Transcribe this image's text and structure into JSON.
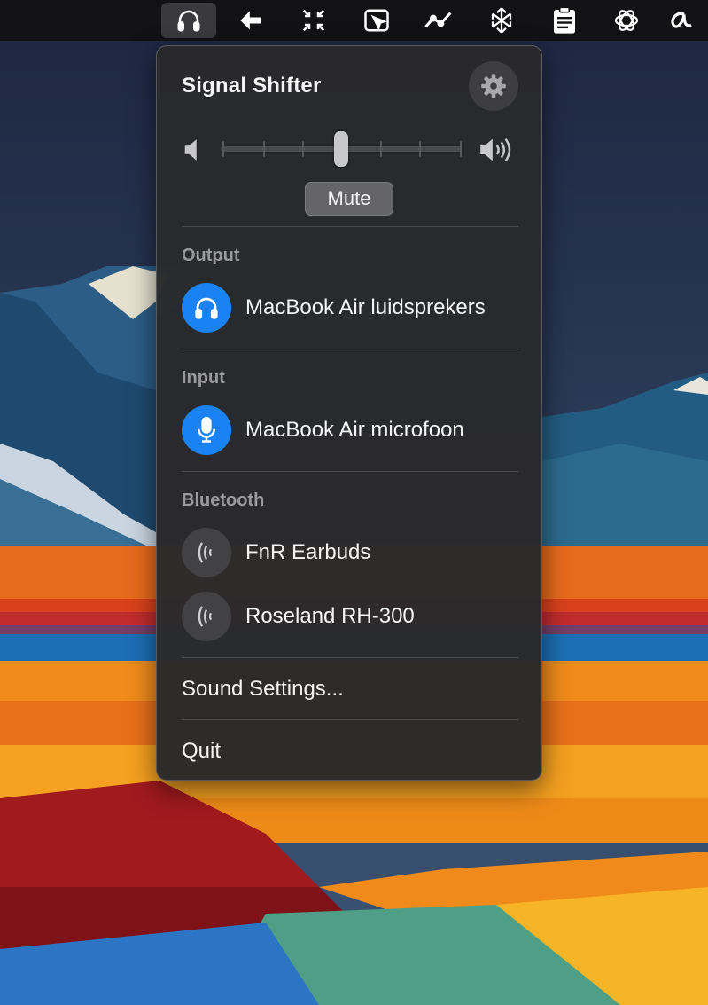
{
  "menubar": {
    "icons": [
      {
        "name": "headphones-icon",
        "active": true
      },
      {
        "name": "back-arrow-icon"
      },
      {
        "name": "collapse-arrows-icon"
      },
      {
        "name": "cursor-tool-icon"
      },
      {
        "name": "graph-icon"
      },
      {
        "name": "snowflake-icon"
      },
      {
        "name": "clipboard-icon"
      },
      {
        "name": "openai-icon"
      },
      {
        "name": "script-a-icon"
      }
    ]
  },
  "panel": {
    "title": "Signal Shifter",
    "settings_icon": "gear-icon",
    "volume": {
      "level_fraction": 0.5,
      "low_icon": "speaker-low-icon",
      "high_icon": "speaker-high-icon"
    },
    "mute_label": "Mute",
    "output": {
      "label": "Output",
      "device": {
        "name": "MacBook Air luidsprekers",
        "icon": "headphones-icon",
        "color": "#1b82f4"
      }
    },
    "input": {
      "label": "Input",
      "device": {
        "name": "MacBook Air microfoon",
        "icon": "microphone-icon",
        "color": "#1b82f4"
      }
    },
    "bluetooth": {
      "label": "Bluetooth",
      "devices": [
        {
          "name": "FnR Earbuds",
          "icon": "bluetooth-signal-icon"
        },
        {
          "name": "Roseland RH-300",
          "icon": "bluetooth-signal-icon"
        }
      ]
    },
    "sound_settings_label": "Sound Settings...",
    "quit_label": "Quit"
  }
}
